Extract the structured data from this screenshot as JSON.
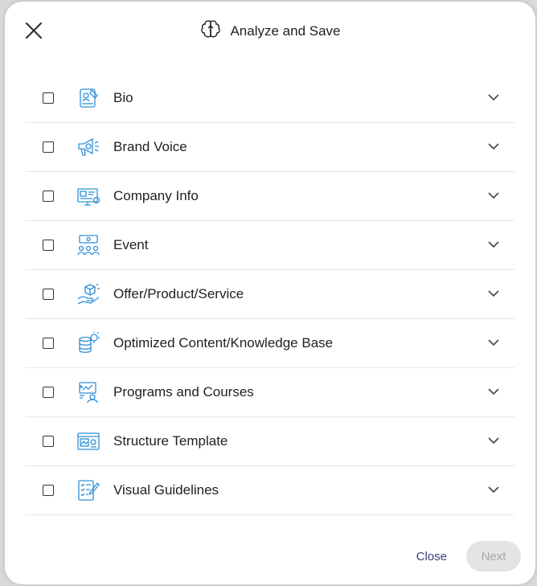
{
  "header": {
    "title": "Analyze and Save",
    "icon": "brain-icon"
  },
  "items": [
    {
      "label": "Bio",
      "icon": "bio-book-icon",
      "checked": false
    },
    {
      "label": "Brand Voice",
      "icon": "megaphone-icon",
      "checked": false
    },
    {
      "label": "Company Info",
      "icon": "company-screen-icon",
      "checked": false
    },
    {
      "label": "Event",
      "icon": "event-people-icon",
      "checked": false
    },
    {
      "label": "Offer/Product/Service",
      "icon": "hand-box-icon",
      "checked": false
    },
    {
      "label": "Optimized Content/Knowledge Base",
      "icon": "database-bulb-icon",
      "checked": false
    },
    {
      "label": "Programs and Courses",
      "icon": "presentation-icon",
      "checked": false
    },
    {
      "label": "Structure Template",
      "icon": "layout-template-icon",
      "checked": false
    },
    {
      "label": "Visual Guidelines",
      "icon": "checklist-pencil-icon",
      "checked": false
    }
  ],
  "footer": {
    "close_label": "Close",
    "next_label": "Next"
  },
  "colors": {
    "icon_blue": "#2f8fd8",
    "close_text": "#3a3f7a",
    "next_bg": "#e4e4e4",
    "next_text": "#a8a8a8"
  }
}
